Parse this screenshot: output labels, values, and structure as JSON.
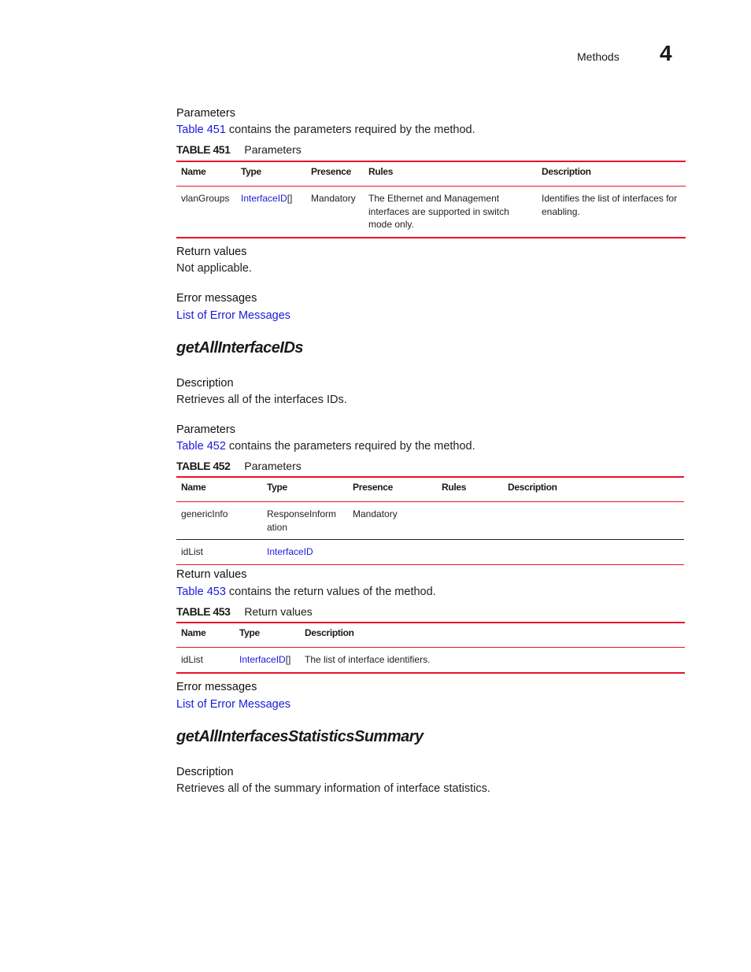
{
  "header": {
    "section": "Methods",
    "chapter": "4"
  },
  "top": {
    "parameters_heading": "Parameters",
    "parameters_link": "Table 451",
    "parameters_text": " contains the parameters required by the method.",
    "table451": {
      "label": "TABLE 451",
      "title": "Parameters",
      "columns": [
        "Name",
        "Type",
        "Presence",
        "Rules",
        "Description"
      ],
      "rows": [
        {
          "name": "vlanGroups",
          "type_link": "InterfaceID",
          "type_suffix": "[]",
          "presence": "Mandatory",
          "rules": "The Ethernet and Management interfaces are supported in switch mode only.",
          "description": "Identifies the list of interfaces for enabling."
        }
      ]
    },
    "return_heading": "Return values",
    "return_text": "Not applicable.",
    "error_heading": "Error messages",
    "error_link": "List of Error Messages"
  },
  "method1": {
    "title": "getAllInterfaceIDs",
    "description_heading": "Description",
    "description_text": "Retrieves all of the interfaces IDs.",
    "parameters_heading": "Parameters",
    "parameters_link": "Table 452",
    "parameters_text": " contains the parameters required by the method.",
    "table452": {
      "label": "TABLE 452",
      "title": "Parameters",
      "columns": [
        "Name",
        "Type",
        "Presence",
        "Rules",
        "Description"
      ],
      "rows": [
        {
          "name": "genericInfo",
          "type": "ResponseInform ation",
          "presence": "Mandatory",
          "rules": "",
          "description": ""
        },
        {
          "name": "idList",
          "type_link": "InterfaceID",
          "presence": "",
          "rules": "",
          "description": ""
        }
      ]
    },
    "return_heading": "Return values",
    "return_link": "Table 453",
    "return_text": " contains the return values of the method.",
    "table453": {
      "label": "TABLE 453",
      "title": "Return values",
      "columns": [
        "Name",
        "Type",
        "Description"
      ],
      "rows": [
        {
          "name": "idList",
          "type_link": "InterfaceID",
          "type_suffix": "[]",
          "description": "The list of interface identifiers."
        }
      ]
    },
    "error_heading": "Error messages",
    "error_link": "List of Error Messages"
  },
  "method2": {
    "title": "getAllInterfacesStatisticsSummary",
    "description_heading": "Description",
    "description_text": "Retrieves all of the summary information of interface statistics."
  }
}
